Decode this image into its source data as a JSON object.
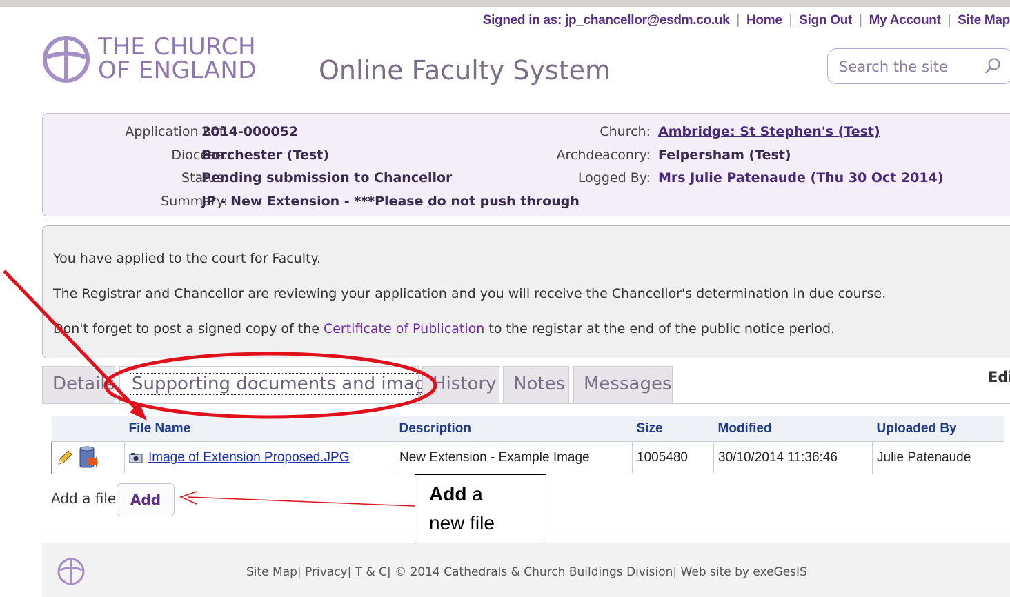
{
  "header": {
    "signed_in": "Signed in as: jp_chancellor@esdm.co.uk",
    "nav": [
      "Home",
      "Sign Out",
      "My Account",
      "Site Map"
    ],
    "logo_line1": "THE CHURCH",
    "logo_line2": "OF ENGLAND",
    "site_title": "Online Faculty System",
    "search_placeholder": "Search the site"
  },
  "application": {
    "ref_label": "Application Ref:",
    "ref": "2014-000052",
    "diocese_label": "Diocese:",
    "diocese": "Borchester (Test)",
    "status_label": "Status:",
    "status": "Pending submission to Chancellor",
    "summary_label": "Summary:",
    "summary": "JP - New Extension - ***Please do not push through",
    "church_label": "Church:",
    "church": "Ambridge: St Stephen's (Test)",
    "archdeaconry_label": "Archdeaconry:",
    "archdeaconry": "Felpersham (Test)",
    "logged_by_label": "Logged By:",
    "logged_by": "Mrs Julie Patenaude (Thu 30 Oct 2014)"
  },
  "message": {
    "line1": "You have applied to the court for Faculty.",
    "line2": "The Registrar and Chancellor are reviewing your application and you will receive the Chancellor's determination in due course.",
    "line3_before": "Don't forget to post a signed copy of the ",
    "line3_link": "Certificate of Publication",
    "line3_after": " to the registar at the end of the public notice period."
  },
  "tabs": [
    "Details",
    "Supporting documents and images",
    "History",
    "Notes",
    "Messages"
  ],
  "active_tab": "Supporting documents and images",
  "edit_label": "Edi",
  "files_table": {
    "columns": [
      "File Name",
      "Description",
      "Size",
      "Modified",
      "Uploaded By"
    ],
    "rows": [
      {
        "file_name": "Image of Extension Proposed.JPG",
        "description": "New Extension - Example Image",
        "size": "1005480",
        "modified": "30/10/2014 11:36:46",
        "uploaded_by": "Julie Patenaude"
      }
    ]
  },
  "add_file": {
    "label": "Add a file",
    "button": "Add"
  },
  "callout": {
    "bold": "Add",
    "rest": " a",
    "line2": "new file"
  },
  "footer": {
    "text": "Site Map| Privacy| T & C| © 2014 Cathedrals & Church Buildings Division| Web site by exeGesIS"
  },
  "colors": {
    "brand_purple": "#8e77b0",
    "annotation_red": "#e0111b",
    "link_blue": "#1b2fb0"
  }
}
